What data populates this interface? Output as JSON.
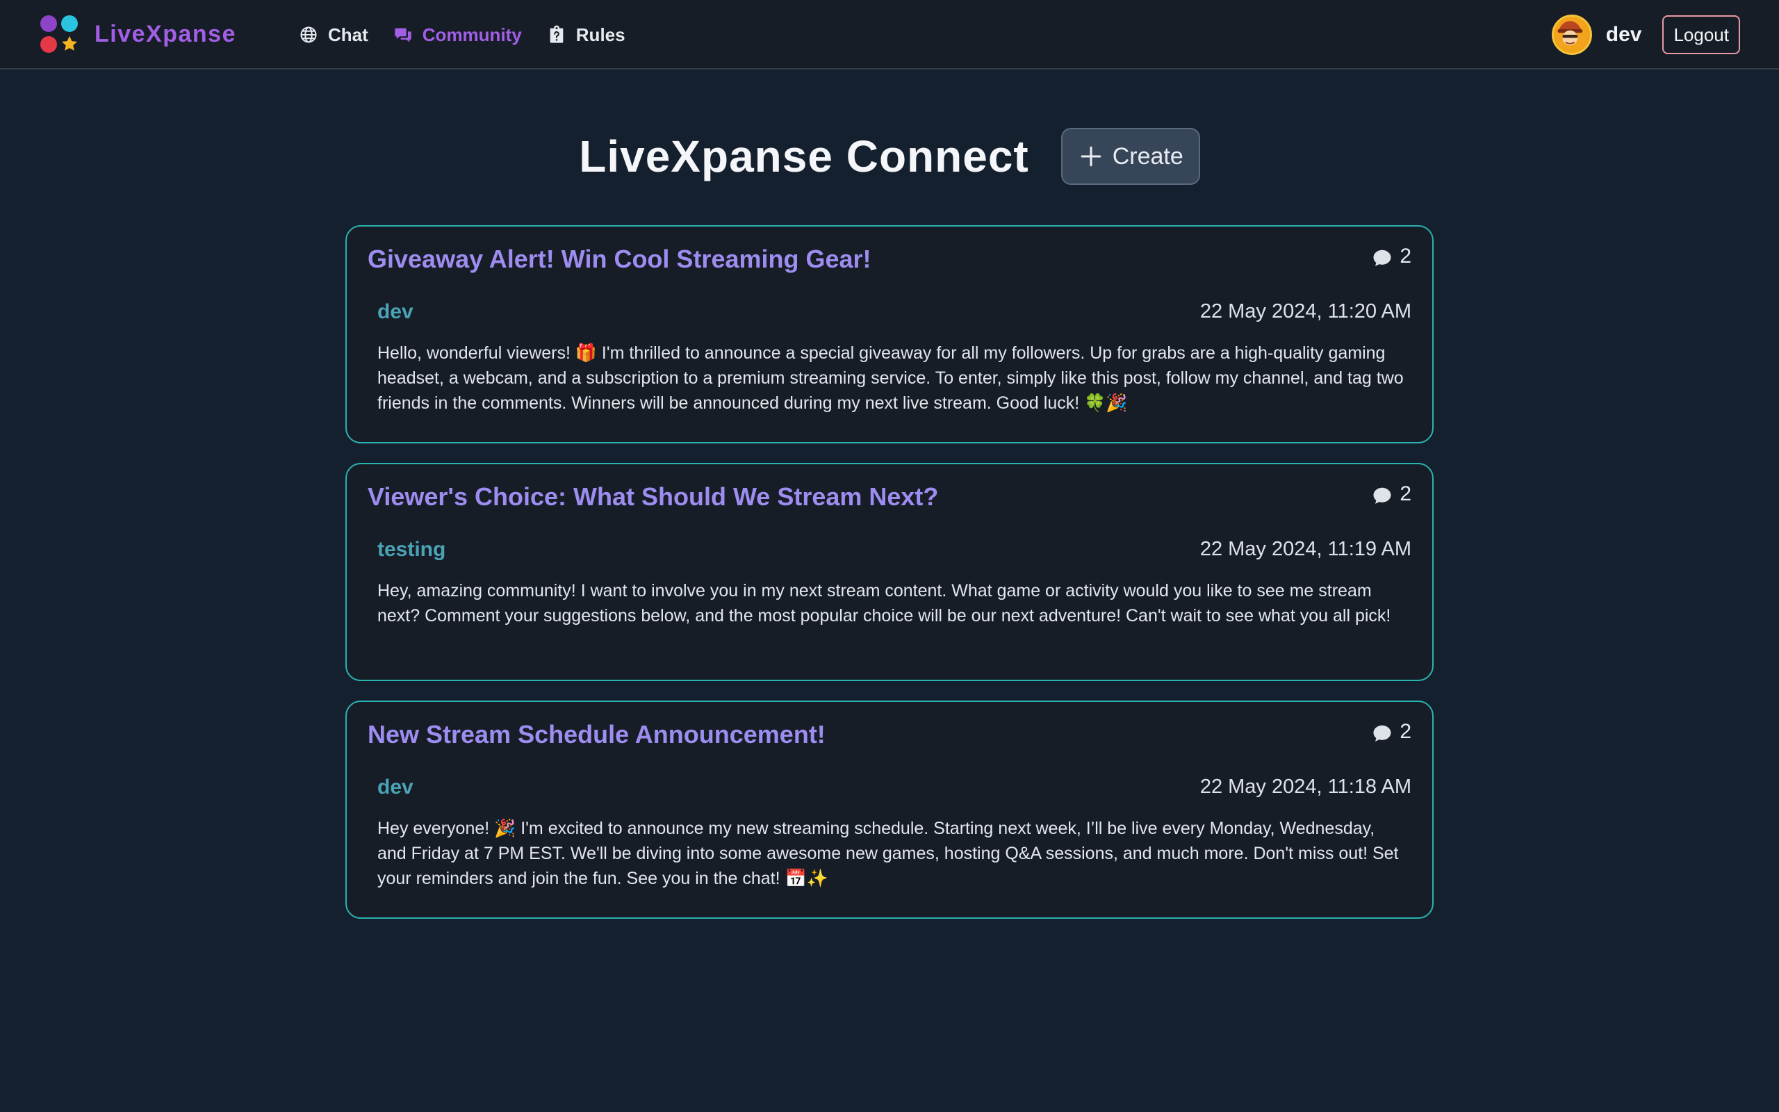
{
  "brand": {
    "name": "LiveXpanse"
  },
  "nav": {
    "items": [
      {
        "label": "Chat",
        "icon": "globe-icon",
        "active": false
      },
      {
        "label": "Community",
        "icon": "chat-bubbles-icon",
        "active": true
      },
      {
        "label": "Rules",
        "icon": "clipboard-question-icon",
        "active": false
      }
    ]
  },
  "user": {
    "name": "dev",
    "logout_label": "Logout"
  },
  "page": {
    "title": "LiveXpanse Connect",
    "create_label": "Create"
  },
  "posts": [
    {
      "title": "Giveaway Alert! Win Cool Streaming Gear!",
      "comments": "2",
      "author": "dev",
      "date": "22 May 2024, 11:20 AM",
      "body": "Hello, wonderful viewers! 🎁 I'm thrilled to announce a special giveaway for all my followers. Up for grabs are a high-quality gaming headset, a webcam, and a subscription to a premium streaming service. To enter, simply like this post, follow my channel, and tag two friends in the comments. Winners will be announced during my next live stream. Good luck! 🍀🎉"
    },
    {
      "title": "Viewer's Choice: What Should We Stream Next?",
      "comments": "2",
      "author": "testing",
      "date": "22 May 2024, 11:19 AM",
      "body": "Hey, amazing community! I want to involve you in my next stream content. What game or activity would you like to see me stream next? Comment your suggestions below, and the most popular choice will be our next adventure! Can't wait to see what you all pick!"
    },
    {
      "title": "New Stream Schedule Announcement!",
      "comments": "2",
      "author": "dev",
      "date": "22 May 2024, 11:18 AM",
      "body": "Hey everyone! 🎉 I'm excited to announce my new streaming schedule. Starting next week, I’ll be live every Monday, Wednesday, and Friday at 7 PM EST. We'll be diving into some awesome new games, hosting Q&A sessions, and much more. Don't miss out! Set your reminders and join the fun. See you in the chat! 📅✨"
    }
  ],
  "colors": {
    "background": "#15202f",
    "navbar": "#171d27",
    "accent_purple": "#a25fe6",
    "post_border": "#2bb3b0",
    "post_title": "#9d8df0",
    "author": "#4aa3b6",
    "logout_border": "#e79aa3"
  }
}
